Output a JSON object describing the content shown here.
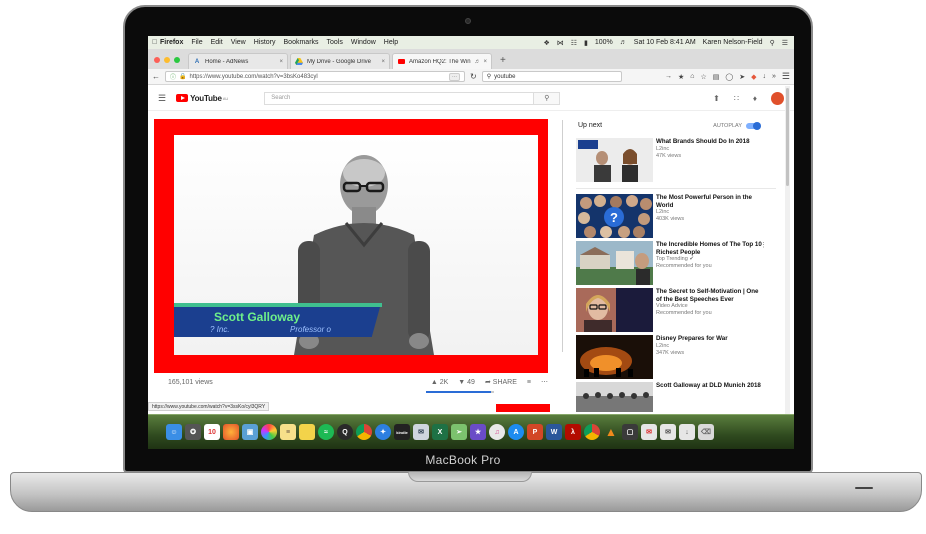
{
  "device": {
    "label": "MacBook Pro"
  },
  "menubar": {
    "app": "Firefox",
    "items": [
      "File",
      "Edit",
      "View",
      "History",
      "Bookmarks",
      "Tools",
      "Window",
      "Help"
    ],
    "battery": "100%",
    "datetime": "Sat 10 Feb  8:41 AM",
    "user": "Karen Nelson-Field"
  },
  "browser": {
    "tabs": [
      {
        "title": "Home - AdNews",
        "favicon": "adnews-icon",
        "active": false
      },
      {
        "title": "My Drive - Google Drive",
        "favicon": "drive-icon",
        "active": false
      },
      {
        "title": "Amazon HQ2: The Win...",
        "favicon": "youtube-icon",
        "active": true
      }
    ],
    "url": "https://www.youtube.com/watch?v=3bsKo483cyl",
    "url_domain": "youtube.com",
    "search_value": "youtube"
  },
  "youtube": {
    "logo_text": "YouTube",
    "logo_sup": "AU",
    "search_placeholder": "Search"
  },
  "video": {
    "lower_third_name": "Scott Galloway",
    "lower_third_org": "? Inc.",
    "lower_third_title": "Professor o",
    "views": "165,101 views",
    "likes": "2K",
    "dislikes": "49",
    "share_label": "SHARE",
    "like_ratio": 0.96,
    "status_url": "https://www.youtube.com/watch?v=3ssKo/cyl3QRY"
  },
  "upnext": {
    "heading": "Up next",
    "autoplay_label": "AUTOPLAY",
    "autoplay_on": true,
    "items": [
      {
        "title": "What Brands Should Do In 2018",
        "channel": "L2inc",
        "meta": "47K views",
        "thumb": "interview"
      },
      {
        "title": "The Most Powerful Person in the World",
        "channel": "L2inc",
        "meta": "403K views",
        "thumb": "faces"
      },
      {
        "title": "The Incredible Homes of The Top 10 Richest People",
        "channel": "Top Trending",
        "meta": "Recommended for you",
        "thumb": "homes"
      },
      {
        "title": "The Secret to Self-Motivation | One of the Best Speeches Ever",
        "channel": "Video Advice",
        "meta": "Recommended for you",
        "thumb": "speech"
      },
      {
        "title": "Disney Prepares for War",
        "channel": "L2inc",
        "meta": "347K views",
        "thumb": "war"
      },
      {
        "title": "Scott Galloway at DLD Munich 2018",
        "channel": "",
        "meta": "",
        "thumb": "stage"
      }
    ]
  },
  "dock": {
    "apps": [
      "finder-icon",
      "launchpad-icon",
      "calendar-icon",
      "firefox-icon",
      "preview-icon",
      "photos-icon",
      "notes-icon",
      "stickies-icon",
      "spotify-icon",
      "quicktime-icon",
      "chrome-icon",
      "safari-icon",
      "kindle-icon",
      "mail-icon",
      "excel-icon",
      "maps-icon",
      "imovie-icon",
      "itunes-icon",
      "appstore-icon",
      "powerpoint-icon",
      "word-icon",
      "acrobat-icon",
      "chrome2-icon",
      "vlc-icon",
      "keynote-icon",
      "messages-icon",
      "mail2-icon",
      "downloads-icon",
      "trash-icon"
    ],
    "calendar_day": "10",
    "kindle_label": "kindle"
  },
  "colors": {
    "youtube_red": "#ff0000",
    "accent_blue": "#2a6cd6",
    "lower_third_green": "#6ef08a",
    "lower_third_navy": "#1b3f8f"
  }
}
